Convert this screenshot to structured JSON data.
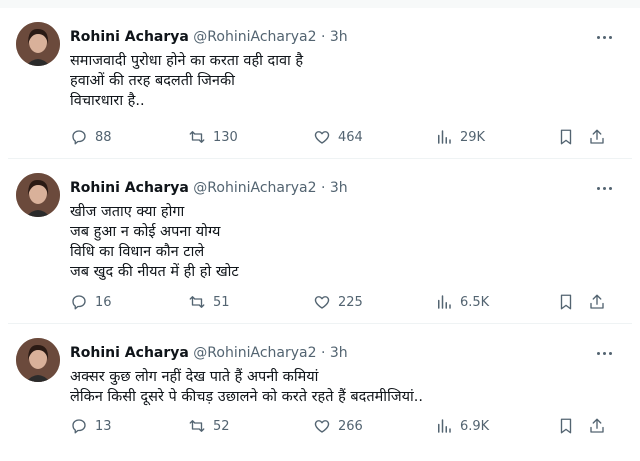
{
  "tweets": [
    {
      "name": "Rohini Acharya",
      "handle": "@RohiniAcharya2",
      "separator": "·",
      "time": "3h",
      "lines": [
        "समाजवादी पुरोधा होने का करता वही दावा है",
        "हवाओं की तरह बदलती जिनकी",
        "विचारधारा है.."
      ],
      "replies": "88",
      "retweets": "130",
      "likes": "464",
      "views": "29K"
    },
    {
      "name": "Rohini Acharya",
      "handle": "@RohiniAcharya2",
      "separator": "·",
      "time": "3h",
      "lines": [
        "खीज जताए क्या होगा",
        "जब हुआ न कोई अपना योग्य",
        "विधि का विधान कौन टाले",
        "जब खुद की नीयत में ही हो खोट"
      ],
      "replies": "16",
      "retweets": "51",
      "likes": "225",
      "views": "6.5K"
    },
    {
      "name": "Rohini Acharya",
      "handle": "@RohiniAcharya2",
      "separator": "·",
      "time": "3h",
      "lines": [
        "अक्सर कुछ लोग नहीं देख पाते हैं अपनी कमियां",
        "लेकिन किसी दूसरे पे कीचड़ उछालने को करते रहते हैं बदतमीजियां.."
      ],
      "replies": "13",
      "retweets": "52",
      "likes": "266",
      "views": "6.9K"
    }
  ],
  "icons": {
    "reply": "reply-icon",
    "retweet": "retweet-icon",
    "like": "heart-icon",
    "views": "views-icon",
    "bookmark": "bookmark-icon",
    "share": "share-icon",
    "more": "more-icon"
  },
  "colors": {
    "text": "#0f1419",
    "secondary": "#536471",
    "divider": "#eff3f4"
  }
}
